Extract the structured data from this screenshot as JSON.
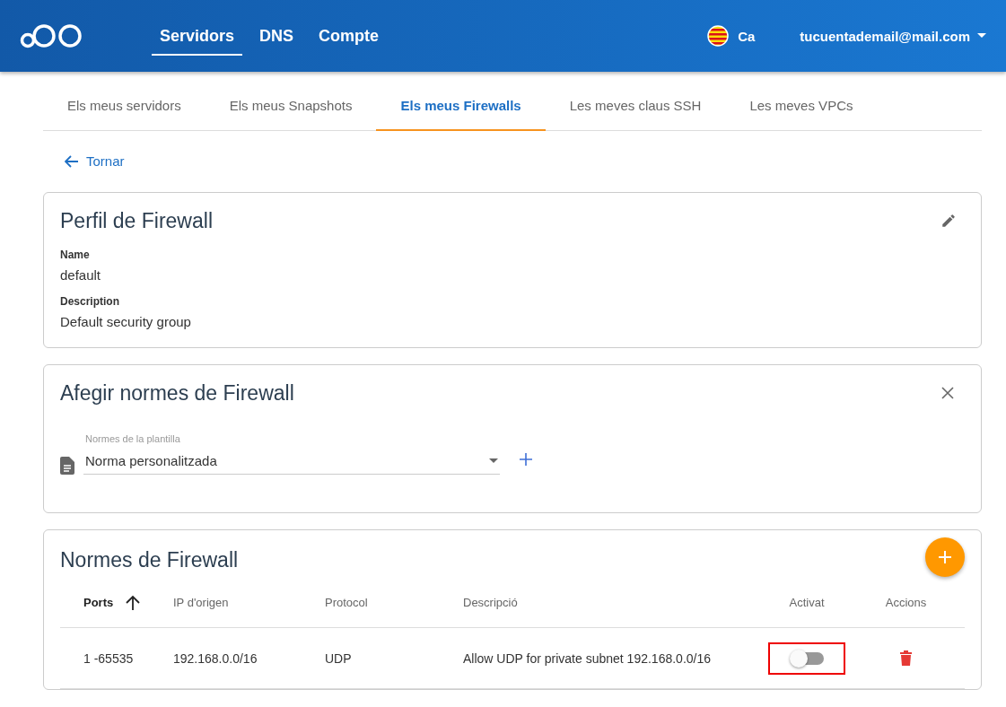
{
  "header": {
    "nav": [
      {
        "label": "Servidors",
        "selected": true
      },
      {
        "label": "DNS",
        "selected": false
      },
      {
        "label": "Compte",
        "selected": false
      }
    ],
    "language": "Ca",
    "account": "tucuentademail@mail.com"
  },
  "tabs": [
    {
      "label": "Els meus servidors",
      "selected": false
    },
    {
      "label": "Els meus Snapshots",
      "selected": false
    },
    {
      "label": "Els meus Firewalls",
      "selected": true
    },
    {
      "label": "Les meves claus SSH",
      "selected": false
    },
    {
      "label": "Les meves VPCs",
      "selected": false
    }
  ],
  "back_link": "Tornar",
  "profile": {
    "title": "Perfil de Firewall",
    "fields": [
      {
        "label": "Name",
        "value": "default"
      },
      {
        "label": "Description",
        "value": "Default security group"
      }
    ]
  },
  "add_rules": {
    "title": "Afegir normes de Firewall",
    "select": {
      "label": "Normes de la plantilla",
      "value": "Norma personalitzada"
    }
  },
  "rules": {
    "title": "Normes de Firewall",
    "columns": [
      {
        "label": "Ports",
        "sorted": true
      },
      {
        "label": "IP d'origen",
        "sorted": false
      },
      {
        "label": "Protocol",
        "sorted": false
      },
      {
        "label": "Descripció",
        "sorted": false
      },
      {
        "label": "Activat",
        "sorted": false
      },
      {
        "label": "Accions",
        "sorted": false
      }
    ],
    "rows": [
      {
        "ports": "1 -65535",
        "ip": "192.168.0.0/16",
        "protocol": "UDP",
        "description": "Allow UDP for private subnet 192.168.0.0/16",
        "on": false,
        "highlighted": true
      }
    ]
  }
}
